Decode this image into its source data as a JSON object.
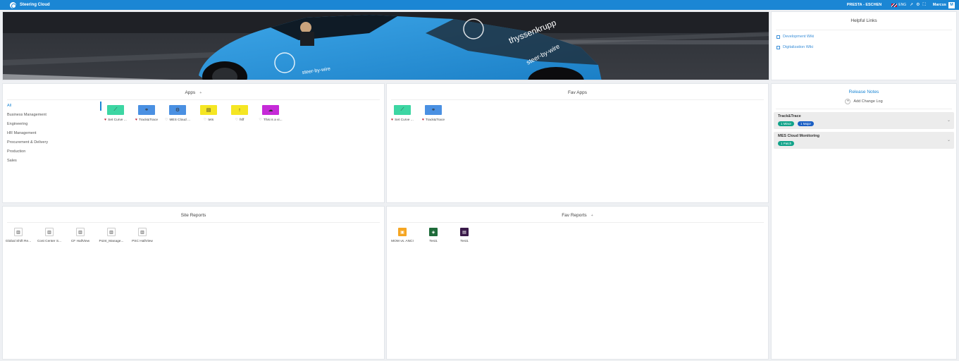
{
  "topbar": {
    "app_name": "Steering Cloud",
    "plant": "PRESTA - ESCHEN",
    "language": "ENG",
    "user_name": "Marcus",
    "user_initial": "M",
    "icons": [
      "flag-uk-icon",
      "pin-icon",
      "settings-icon",
      "fullscreen-icon"
    ]
  },
  "banner": {
    "car_text_1": "thyssenkrupp",
    "car_text_2": "steer-by-wire",
    "car_text_3": "steer-by-wire"
  },
  "helpful_links": {
    "title": "Helpful Links",
    "links": [
      {
        "label": "Development Wiki"
      },
      {
        "label": "Digitalization Wiki"
      }
    ]
  },
  "apps": {
    "title": "Apps",
    "add_symbol": "+",
    "categories": [
      "All",
      "Business Management",
      "Engineering",
      "HR Management",
      "Procurement & Delivery",
      "Production",
      "Sales"
    ],
    "items": [
      {
        "label": "Set Curve ...",
        "color": "#3dd6a3",
        "glyph": "⟋",
        "fav": true
      },
      {
        "label": "Track&Trace",
        "color": "#4a90e2",
        "glyph": "⚭",
        "fav": true
      },
      {
        "label": "MES Cloud ...",
        "color": "#4a90e2",
        "glyph": "⚙",
        "fav": false
      },
      {
        "label": "tets",
        "color": "#f5e623",
        "glyph": "▤",
        "fav": false
      },
      {
        "label": "fsff",
        "color": "#f5e623",
        "glyph": "↑",
        "fav": false
      },
      {
        "label": "This is a vi...",
        "color": "#c62ad8",
        "glyph": "☁",
        "fav": false
      }
    ]
  },
  "fav_apps": {
    "title": "Fav Apps",
    "items": [
      {
        "label": "Set Curve ...",
        "color": "#3dd6a3",
        "glyph": "⟋"
      },
      {
        "label": "Track&Trace",
        "color": "#4a90e2",
        "glyph": "⚭"
      }
    ]
  },
  "release_notes": {
    "title": "Release Notes",
    "add_label": "Add Change Log",
    "items": [
      {
        "title": "Track&Trace",
        "badges": [
          {
            "label": "1 Minor",
            "color": "#12a38a"
          },
          {
            "label": "1 Major",
            "color": "#1b5fc4"
          }
        ]
      },
      {
        "title": "MES Cloud Monitoring",
        "badges": [
          {
            "label": "1 Patch",
            "color": "#12a38a"
          }
        ]
      }
    ]
  },
  "site_reports": {
    "title": "Site Reports",
    "items": [
      {
        "label": "Global Shift Re..."
      },
      {
        "label": "Cost Center S..."
      },
      {
        "label": "CF HallView"
      },
      {
        "label": "Point_Manage..."
      },
      {
        "label": "PSC HallView"
      }
    ]
  },
  "fav_reports": {
    "title": "Fav Reports",
    "add_symbol": "+",
    "items": [
      {
        "label": "MOM vs. ANCI",
        "color": "#f5a623",
        "glyph": "▣"
      },
      {
        "label": "Test1",
        "color": "#1e6b3a",
        "glyph": "◈"
      },
      {
        "label": "Test1",
        "color": "#3a1a4a",
        "glyph": "▤"
      }
    ]
  }
}
